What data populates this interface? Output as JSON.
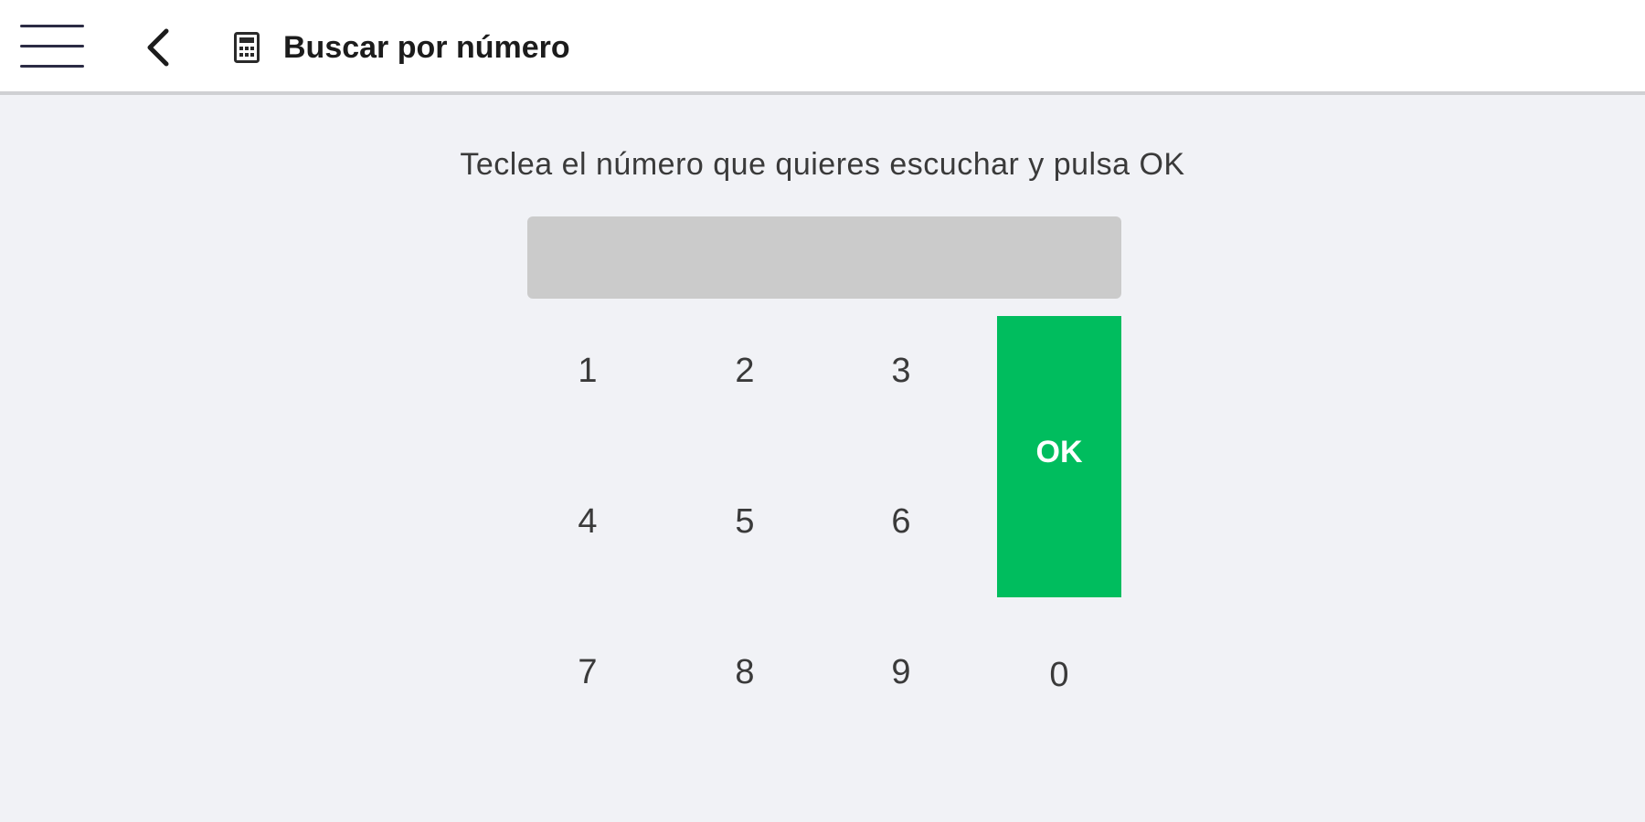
{
  "header": {
    "title": "Buscar por número",
    "menu_icon": "hamburger-menu-icon",
    "back_icon": "chevron-left-icon",
    "title_icon": "calculator-icon"
  },
  "instruction": "Teclea el número que quieres escuchar y pulsa OK",
  "input": {
    "value": "",
    "placeholder": ""
  },
  "keypad": {
    "keys": [
      "1",
      "2",
      "3",
      "4",
      "5",
      "6",
      "7",
      "8",
      "9",
      "0"
    ],
    "ok_label": "OK"
  },
  "colors": {
    "accent": "#00bd5e",
    "background": "#f1f2f6",
    "input_bg": "#cbcbcb",
    "header_bg": "#ffffff"
  }
}
